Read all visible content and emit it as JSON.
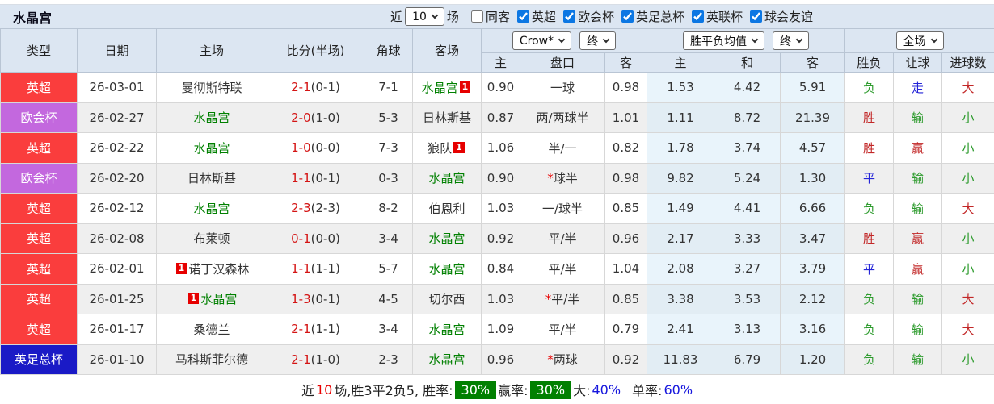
{
  "header": {
    "title": "水晶宫",
    "near_label": "近",
    "matches_count": "10",
    "matches_label": "场",
    "filters": [
      {
        "label": "同客",
        "checked": false
      },
      {
        "label": "英超",
        "checked": true
      },
      {
        "label": "欧会杯",
        "checked": true
      },
      {
        "label": "英足总杯",
        "checked": true
      },
      {
        "label": "英联杯",
        "checked": true
      },
      {
        "label": "球会友谊",
        "checked": true
      }
    ]
  },
  "colors": {
    "league_red": "#fa3d3d",
    "league_purple": "#c368de",
    "league_blue": "#1a1ac6",
    "team_green": "#008000",
    "score_red": "#d41414",
    "result_red": "#c22727",
    "result_green": "#2d9b2d",
    "result_blue": "#2525d8",
    "rate_badge_green": "#018001",
    "header_bg": "#dce6f2"
  },
  "table": {
    "left_headers": [
      "类型",
      "日期",
      "主场",
      "比分(半场)",
      "角球",
      "客场"
    ],
    "odds_group": {
      "bookmaker": "Crow*",
      "period": "终",
      "sub": [
        "主",
        "盘口",
        "客"
      ]
    },
    "mean_group": {
      "name": "胜平负均值",
      "period": "终",
      "sub": [
        "主",
        "和",
        "客"
      ]
    },
    "result_group": {
      "scope": "全场",
      "sub": [
        "胜负",
        "让球",
        "进球数"
      ]
    },
    "rows": [
      {
        "type": "英超",
        "type_color": "red",
        "date": "26-03-01",
        "home": "曼彻斯特联",
        "home_green": false,
        "home_badge": "",
        "score": "2-1",
        "half": "(0-1)",
        "corner": "7-1",
        "away": "水晶宫",
        "away_green": true,
        "away_badge": "1",
        "odds_home": "0.90",
        "handicap": "一球",
        "handicap_star": false,
        "odds_away": "0.98",
        "mean_home": "1.53",
        "mean_draw": "4.42",
        "mean_away": "5.91",
        "result": "负",
        "result_color": "green",
        "handicap_result": "走",
        "handicap_result_color": "blue",
        "goals": "大",
        "goals_color": "red"
      },
      {
        "type": "欧会杯",
        "type_color": "purple",
        "date": "26-02-27",
        "home": "水晶宫",
        "home_green": true,
        "home_badge": "",
        "score": "2-0",
        "half": "(1-0)",
        "corner": "5-3",
        "away": "日林斯基",
        "away_green": false,
        "away_badge": "",
        "odds_home": "0.87",
        "handicap": "两/两球半",
        "handicap_star": false,
        "odds_away": "1.01",
        "mean_home": "1.11",
        "mean_draw": "8.72",
        "mean_away": "21.39",
        "result": "胜",
        "result_color": "red",
        "handicap_result": "输",
        "handicap_result_color": "green",
        "goals": "小",
        "goals_color": "green"
      },
      {
        "type": "英超",
        "type_color": "red",
        "date": "26-02-22",
        "home": "水晶宫",
        "home_green": true,
        "home_badge": "",
        "score": "1-0",
        "half": "(0-0)",
        "corner": "7-3",
        "away": "狼队",
        "away_green": false,
        "away_badge": "1",
        "odds_home": "1.06",
        "handicap": "半/一",
        "handicap_star": false,
        "odds_away": "0.82",
        "mean_home": "1.78",
        "mean_draw": "3.74",
        "mean_away": "4.57",
        "result": "胜",
        "result_color": "red",
        "handicap_result": "赢",
        "handicap_result_color": "red",
        "goals": "小",
        "goals_color": "green"
      },
      {
        "type": "欧会杯",
        "type_color": "purple",
        "date": "26-02-20",
        "home": "日林斯基",
        "home_green": false,
        "home_badge": "",
        "score": "1-1",
        "half": "(0-1)",
        "corner": "0-3",
        "away": "水晶宫",
        "away_green": true,
        "away_badge": "",
        "odds_home": "0.90",
        "handicap": "球半",
        "handicap_star": true,
        "odds_away": "0.98",
        "mean_home": "9.82",
        "mean_draw": "5.24",
        "mean_away": "1.30",
        "result": "平",
        "result_color": "blue",
        "handicap_result": "输",
        "handicap_result_color": "green",
        "goals": "小",
        "goals_color": "green"
      },
      {
        "type": "英超",
        "type_color": "red",
        "date": "26-02-12",
        "home": "水晶宫",
        "home_green": true,
        "home_badge": "",
        "score": "2-3",
        "half": "(2-3)",
        "corner": "8-2",
        "away": "伯恩利",
        "away_green": false,
        "away_badge": "",
        "odds_home": "1.03",
        "handicap": "一/球半",
        "handicap_star": false,
        "odds_away": "0.85",
        "mean_home": "1.49",
        "mean_draw": "4.41",
        "mean_away": "6.66",
        "result": "负",
        "result_color": "green",
        "handicap_result": "输",
        "handicap_result_color": "green",
        "goals": "大",
        "goals_color": "red"
      },
      {
        "type": "英超",
        "type_color": "red",
        "date": "26-02-08",
        "home": "布莱顿",
        "home_green": false,
        "home_badge": "",
        "score": "0-1",
        "half": "(0-0)",
        "corner": "3-4",
        "away": "水晶宫",
        "away_green": true,
        "away_badge": "",
        "odds_home": "0.92",
        "handicap": "平/半",
        "handicap_star": false,
        "odds_away": "0.96",
        "mean_home": "2.17",
        "mean_draw": "3.33",
        "mean_away": "3.47",
        "result": "胜",
        "result_color": "red",
        "handicap_result": "赢",
        "handicap_result_color": "red",
        "goals": "小",
        "goals_color": "green"
      },
      {
        "type": "英超",
        "type_color": "red",
        "date": "26-02-01",
        "home": "诺丁汉森林",
        "home_green": false,
        "home_badge": "1",
        "score": "1-1",
        "half": "(1-1)",
        "corner": "5-7",
        "away": "水晶宫",
        "away_green": true,
        "away_badge": "",
        "odds_home": "0.84",
        "handicap": "平/半",
        "handicap_star": false,
        "odds_away": "1.04",
        "mean_home": "2.08",
        "mean_draw": "3.27",
        "mean_away": "3.79",
        "result": "平",
        "result_color": "blue",
        "handicap_result": "赢",
        "handicap_result_color": "red",
        "goals": "小",
        "goals_color": "green"
      },
      {
        "type": "英超",
        "type_color": "red",
        "date": "26-01-25",
        "home": "水晶宫",
        "home_green": true,
        "home_badge": "1",
        "score": "1-3",
        "half": "(0-1)",
        "corner": "4-5",
        "away": "切尔西",
        "away_green": false,
        "away_badge": "",
        "odds_home": "1.03",
        "handicap": "平/半",
        "handicap_star": true,
        "odds_away": "0.85",
        "mean_home": "3.38",
        "mean_draw": "3.53",
        "mean_away": "2.12",
        "result": "负",
        "result_color": "green",
        "handicap_result": "输",
        "handicap_result_color": "green",
        "goals": "大",
        "goals_color": "red"
      },
      {
        "type": "英超",
        "type_color": "red",
        "date": "26-01-17",
        "home": "桑德兰",
        "home_green": false,
        "home_badge": "",
        "score": "2-1",
        "half": "(1-1)",
        "corner": "3-4",
        "away": "水晶宫",
        "away_green": true,
        "away_badge": "",
        "odds_home": "1.09",
        "handicap": "平/半",
        "handicap_star": false,
        "odds_away": "0.79",
        "mean_home": "2.41",
        "mean_draw": "3.13",
        "mean_away": "3.16",
        "result": "负",
        "result_color": "green",
        "handicap_result": "输",
        "handicap_result_color": "green",
        "goals": "大",
        "goals_color": "red"
      },
      {
        "type": "英足总杯",
        "type_color": "blue",
        "date": "26-01-10",
        "home": "马科斯菲尔德",
        "home_green": false,
        "home_badge": "",
        "score": "2-1",
        "half": "(1-0)",
        "corner": "2-3",
        "away": "水晶宫",
        "away_green": true,
        "away_badge": "",
        "odds_home": "0.96",
        "handicap": "两球",
        "handicap_star": true,
        "odds_away": "0.92",
        "mean_home": "11.83",
        "mean_draw": "6.79",
        "mean_away": "1.20",
        "result": "负",
        "result_color": "green",
        "handicap_result": "输",
        "handicap_result_color": "green",
        "goals": "小",
        "goals_color": "green"
      }
    ]
  },
  "footer": {
    "near_label": "近",
    "count": "10",
    "summary": "场,胜3平2负5, 胜率:",
    "win_rate": "30%",
    "profit_label": "赢率:",
    "profit_rate": "30%",
    "big_label": "大:",
    "big_rate": "40%",
    "single_label": "单率:",
    "single_rate": "60%"
  }
}
